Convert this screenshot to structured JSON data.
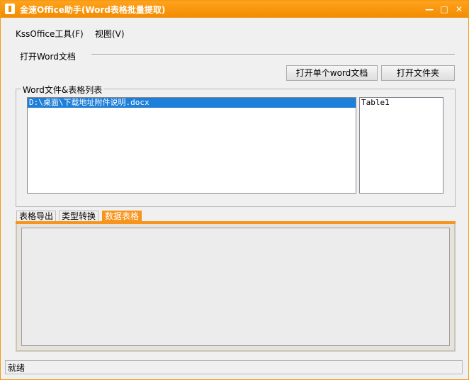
{
  "window": {
    "title": "金速Office助手(Word表格批量提取)",
    "controls": {
      "minimize": "—",
      "maximize": "□",
      "close": "✕"
    }
  },
  "menubar": {
    "items": [
      "KssOffice工具(F)",
      "视图(V)"
    ]
  },
  "open_section": {
    "label": "打开Word文档",
    "open_single_button": "打开单个word文档",
    "open_folder_button": "打开文件夹"
  },
  "file_list_group": {
    "label": "Word文件&表格列表",
    "files": [
      "D:\\桌面\\下载地址附件说明.docx"
    ],
    "selected_index": 0,
    "tables": [
      "Table1"
    ]
  },
  "tabs": {
    "items": [
      "表格导出",
      "类型转换",
      "数据表格"
    ],
    "active_index": 2
  },
  "statusbar": {
    "text": "就绪"
  },
  "colors": {
    "accent": "#f7941d",
    "selection": "#1e7fd8"
  }
}
